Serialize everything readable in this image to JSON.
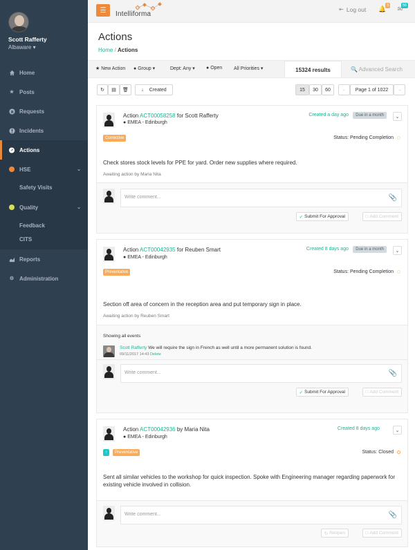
{
  "user": {
    "name": "Scott Rafferty",
    "org": "Albaware ▾"
  },
  "nav": [
    {
      "label": "Home",
      "icon": "home-icon"
    },
    {
      "label": "Posts",
      "icon": "star-icon"
    },
    {
      "label": "Requests",
      "icon": "request-icon"
    },
    {
      "label": "Incidents",
      "icon": "incident-icon"
    },
    {
      "label": "Actions",
      "icon": "actions-icon"
    },
    {
      "label": "HSE",
      "icon": "dot-orange-icon"
    },
    {
      "label": "Quality",
      "icon": "dot-yellow-icon"
    },
    {
      "label": "Reports",
      "icon": "chart-icon"
    },
    {
      "label": "Administration",
      "icon": "gear-icon"
    }
  ],
  "nav_sub": {
    "hse": [
      "Safety Visits"
    ],
    "quality": [
      "Feedback",
      "CITS"
    ]
  },
  "topbar": {
    "logo": "Intelliforma",
    "logout": "Log out",
    "notif_count": "5",
    "msg_count": "56"
  },
  "page": {
    "title": "Actions",
    "crumb_home": "Home",
    "crumb_current": "Actions"
  },
  "toolbar": {
    "new_action": "New Action",
    "group": "Group ▾",
    "dept": "Dept: Any ▾",
    "open": "Open",
    "priorities": "All Priorities ▾",
    "results": "15324 results",
    "advanced": "Advanced Search"
  },
  "controls": {
    "sort_label": "Created",
    "page_sizes": [
      "15",
      "30",
      "60"
    ],
    "prev": "←",
    "page_info": "Page 1 of 1022",
    "next": "→"
  },
  "actions": [
    {
      "prefix": "Action",
      "ref": "ACT00058258",
      "assignee_text": "for Scott Rafferty",
      "location": "EMEA - Edinburgh",
      "created": "Created a day ago",
      "due": "Due in a month",
      "labels": [
        "Corrective"
      ],
      "status": "Status: Pending Completion",
      "description": "Check stores stock levels for PPE for yard. Order new supplies where required.",
      "awaiting": "Awaiting action by Maria Nita",
      "comment_placeholder": "Write comment...",
      "primary_btn": "Submit For Approval",
      "secondary_btn": "Add Comment"
    },
    {
      "prefix": "Action",
      "ref": "ACT00042935",
      "assignee_text": "for Reuben Smart",
      "location": "EMEA - Edinburgh",
      "created": "Created 8 days ago",
      "due": "Due in a month",
      "labels": [
        "Preventative"
      ],
      "status": "Status: Pending Completion",
      "description": "Section off area of concern in the reception area and put temporary sign in place.",
      "awaiting": "Awaiting action by Reuben Smart",
      "events_title": "Showing all events",
      "event": {
        "author": "Scott Rafferty",
        "text": "We will require the sign in French as well until a more permanent solution is found.",
        "time": "09/11/2017 14:43",
        "delete": "Delete"
      },
      "comment_placeholder": "Write comment...",
      "primary_btn": "Submit For Approval",
      "secondary_btn": "Add Comment"
    },
    {
      "prefix": "Action",
      "ref": "ACT00042936",
      "assignee_text": "by Maria Nita",
      "location": "EMEA - Edinburgh",
      "created": "Created 8 days ago",
      "labels": [
        "Preventative"
      ],
      "status": "Status: Closed",
      "description": "Sent all similar vehicles to the workshop for quick inspection. Spoke with Engineering manager regarding paperwork for existing vehicle involved in collision.",
      "comment_placeholder": "Write comment...",
      "primary_btn": "Reopen",
      "secondary_btn": "Add Comment"
    }
  ],
  "colors": {
    "sidebar": "#2f4050",
    "accent": "#f0883a",
    "link": "#1ab394",
    "label_orange": "#f8ac59",
    "label_teal": "#23c6c8"
  }
}
